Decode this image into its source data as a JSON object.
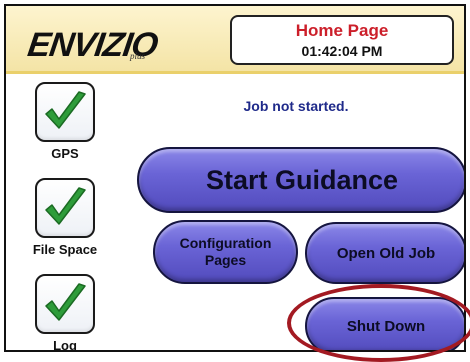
{
  "header": {
    "logo_text": "ENVIZIO",
    "logo_sub": "plus",
    "title": "Home Page",
    "clock": "01:42:04 PM",
    "accent_color": "#cc1f2a",
    "header_bg": "#f4e4a6"
  },
  "status": {
    "items": [
      {
        "label": "GPS",
        "state": "ok",
        "icon": "check-icon"
      },
      {
        "label": "File Space",
        "state": "ok",
        "icon": "check-icon"
      },
      {
        "label": "Log",
        "state": "ok",
        "icon": "check-icon"
      }
    ],
    "check_color": "#2e9c3a"
  },
  "main": {
    "job_status": "Job not started.",
    "start_guidance_label": "Start Guidance",
    "configuration_label_line1": "Configuration",
    "configuration_label_line2": "Pages",
    "open_old_job_label": "Open Old Job",
    "shut_down_label": "Shut Down",
    "button_color": "#6a64d6",
    "highlight_color": "#a31a22"
  }
}
